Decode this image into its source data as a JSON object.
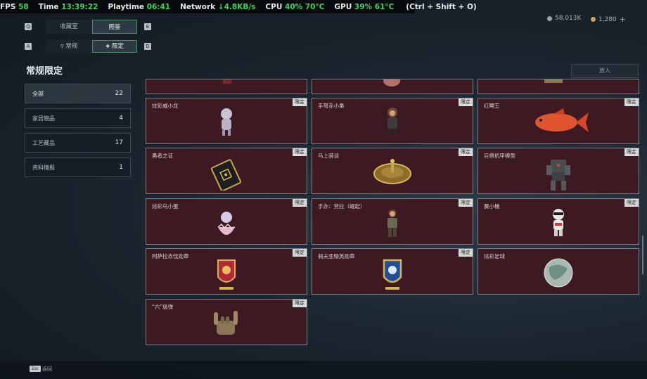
{
  "overlay": {
    "fps_label": "FPS",
    "fps_value": "58",
    "time_label": "Time",
    "time_value": "13:39:22",
    "playtime_label": "Playtime",
    "playtime_value": "06:41",
    "network_label": "Network",
    "network_value": "↓4.8KB/s",
    "cpu_label": "CPU",
    "cpu_load": "40%",
    "cpu_temp": "70°C",
    "gpu_label": "GPU",
    "gpu_load": "39%",
    "gpu_temp": "61°C",
    "hotkey": "(Ctrl + Shift + O)"
  },
  "tabs_top": {
    "left_key": "Q",
    "right_key": "E",
    "items": [
      "收藏室",
      "图鉴"
    ],
    "active": "图鉴"
  },
  "tabs_sub": {
    "left_key": "A",
    "right_key": "D",
    "items": [
      "常规",
      "限定"
    ],
    "active": "限定"
  },
  "page_title": "常规限定",
  "sidebar": {
    "items": [
      {
        "label": "全部",
        "count": "22"
      },
      {
        "label": "家居物品",
        "count": "4"
      },
      {
        "label": "工艺藏品",
        "count": "17"
      },
      {
        "label": "资料情报",
        "count": "1"
      }
    ]
  },
  "currency": {
    "amount_a": "58,013K",
    "amount_b": "1,280",
    "add": "+"
  },
  "search": {
    "label": "放入"
  },
  "badge_text": "限定",
  "items": [
    {
      "name": "炫彩威小龙",
      "icon": "figure-icon"
    },
    {
      "name": "手弩赤小梟",
      "icon": "figure-icon"
    },
    {
      "name": "红鲤王",
      "icon": "fish-icon"
    },
    {
      "name": "勇者之证",
      "icon": "card-icon"
    },
    {
      "name": "马上骑谈",
      "icon": "disc-icon"
    },
    {
      "name": "巨兽机甲模型",
      "icon": "mech-icon"
    },
    {
      "name": "炫彩乌小蛋",
      "icon": "egg-figure-icon"
    },
    {
      "name": "手办：劳拉（崛起）",
      "icon": "figure-icon"
    },
    {
      "name": "赛小桶",
      "icon": "robot-icon"
    },
    {
      "name": "阿萨拉赤忱勋章",
      "icon": "medal-icon"
    },
    {
      "name": "骑夫亚精英勋章",
      "icon": "medal-icon"
    },
    {
      "name": "炫彩足球",
      "icon": "ball-icon"
    },
    {
      "name": "“六”级弹",
      "icon": "hand-icon"
    }
  ],
  "footer": {
    "esc_key": "Esc",
    "esc_label": "返回"
  },
  "colors": {
    "accent": "#38d45c",
    "card_bg": "#3d1a22",
    "card_border": "#7e8286"
  }
}
